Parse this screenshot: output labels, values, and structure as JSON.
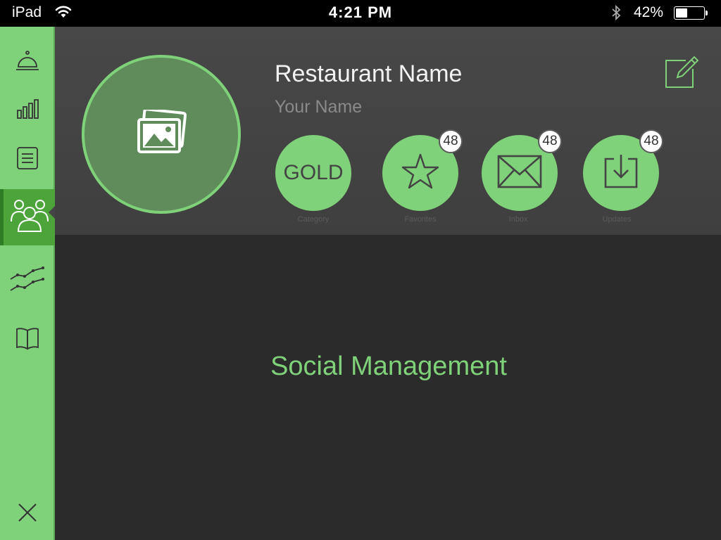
{
  "status_bar": {
    "device": "iPad",
    "time": "4:21 PM",
    "battery_text": "42%",
    "battery_level": 0.42
  },
  "sidebar": {
    "items": [
      {
        "icon": "bell-icon",
        "active": false
      },
      {
        "icon": "bar-chart-icon",
        "active": false
      },
      {
        "icon": "list-icon",
        "active": false
      },
      {
        "icon": "users-icon",
        "active": true
      },
      {
        "icon": "line-chart-icon",
        "active": false
      },
      {
        "icon": "book-icon",
        "active": false
      }
    ],
    "close_icon": "close-icon"
  },
  "profile": {
    "restaurant_name": "Restaurant Name",
    "user_name": "Your Name",
    "avatar_icon": "photos-icon",
    "edit_icon": "edit-icon"
  },
  "stats": [
    {
      "value": "GOLD",
      "label": "Category",
      "badge": ""
    },
    {
      "icon": "star-icon",
      "label": "Favorites",
      "badge": "48"
    },
    {
      "icon": "envelope-icon",
      "label": "Inbox",
      "badge": "48"
    },
    {
      "icon": "download-icon",
      "label": "Updates",
      "badge": "48"
    }
  ],
  "main": {
    "title": "Social Management"
  },
  "colors": {
    "accent": "#7fd279",
    "accent_dark": "#4ca43b",
    "background": "#2b2b2b",
    "header": "#444444"
  }
}
